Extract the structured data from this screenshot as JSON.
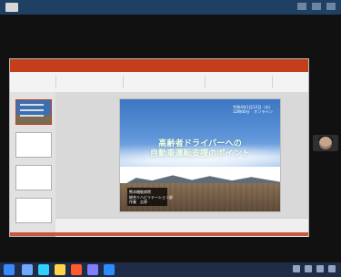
{
  "top_bar": {
    "left_icon": "window-icon",
    "right_controls": [
      "minimize-icon",
      "maximize-icon",
      "close-icon"
    ]
  },
  "powerpoint": {
    "colors": {
      "accent": "#c43e1c",
      "ribbon_bg": "#f3f3f3",
      "panel_bg": "#e1e1e1"
    },
    "slide": {
      "date_lines": "令和4年1月12日（水）\n12時00分　オンライン",
      "title": "高齢者ドライバーへの\n自動車運転支援のポイント",
      "presenter": "熊本機能病院\n総合リハビリテーション部\n作業　吉原"
    }
  },
  "webcam": {
    "label": "participant-video"
  },
  "taskbar": {
    "icons": [
      "start-icon",
      "explorer-icon",
      "browser-icon",
      "mail-icon",
      "powerpoint-icon",
      "teams-icon",
      "zoom-icon"
    ],
    "tray_icons": [
      "network-icon",
      "volume-icon",
      "battery-icon",
      "clock-icon"
    ]
  }
}
